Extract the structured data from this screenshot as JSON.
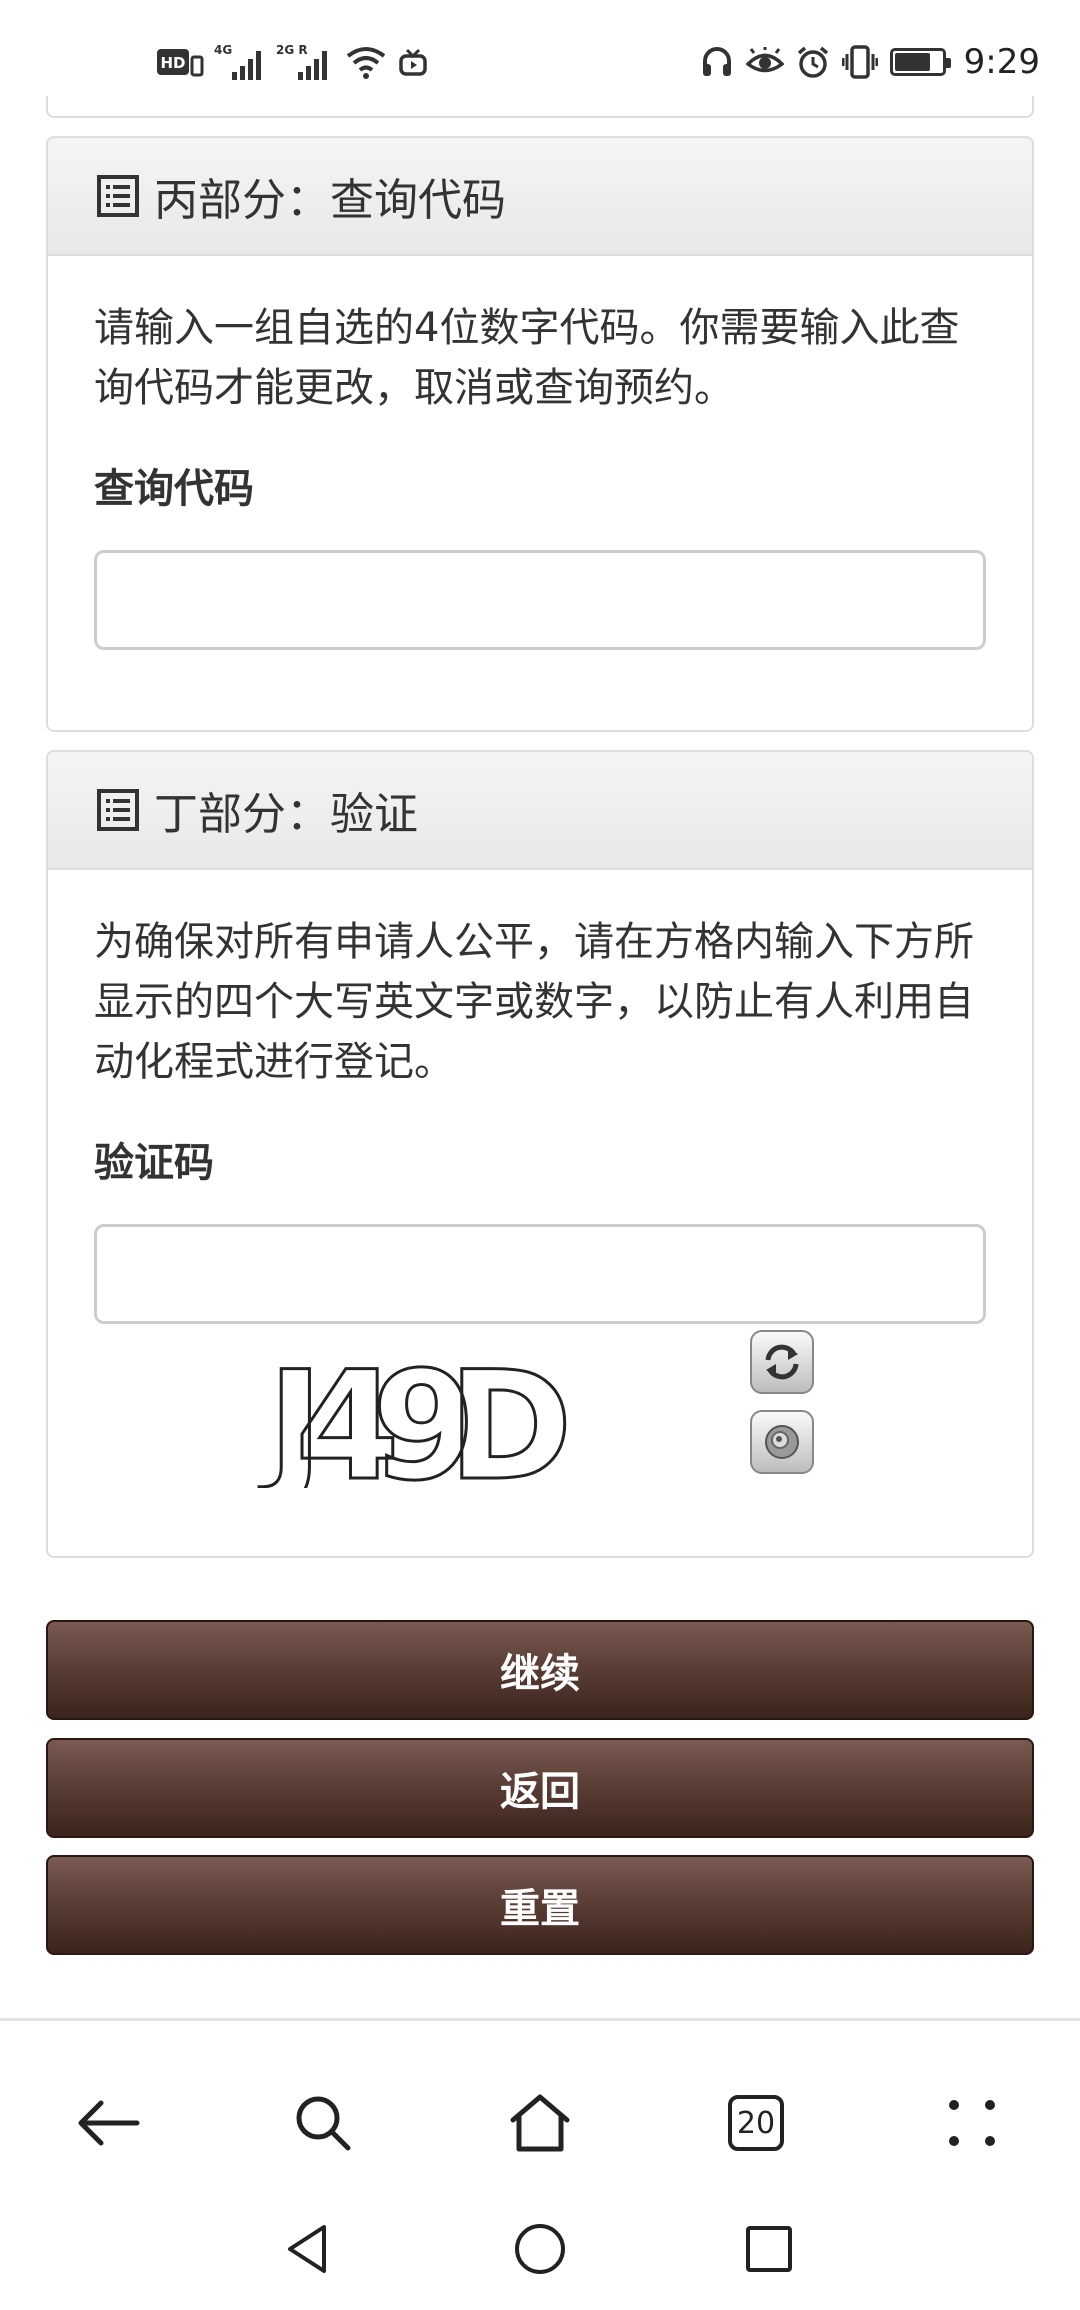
{
  "status_bar": {
    "left_indicators": [
      "HD",
      "4G",
      "2G R"
    ],
    "time": "9:29",
    "icons": [
      "hd-icon",
      "signal-4g-icon",
      "signal-2g-icon",
      "wifi-icon",
      "tv-icon",
      "headphones-icon",
      "eye-icon",
      "alarm-icon",
      "vibrate-icon",
      "battery-icon"
    ],
    "battery_level": 0.75
  },
  "section_c": {
    "title": "丙部分：查询代码",
    "description": "请输入一组自选的4位数字代码。你需要输入此查询代码才能更改，取消或查询预约。",
    "field_label": "查询代码",
    "field_value": ""
  },
  "section_d": {
    "title": "丁部分：验证",
    "description": "为确保对所有申请人公平，请在方格内输入下方所显示的四个大写英文字或数字，以防止有人利用自动化程式进行登记。",
    "field_label": "验证码",
    "field_value": "",
    "captcha_text": "J49D"
  },
  "buttons": {
    "continue": "继续",
    "back": "返回",
    "reset": "重置"
  },
  "browser_toolbar": {
    "tab_count": "20",
    "items": [
      "back-arrow-icon",
      "search-icon",
      "home-icon",
      "tabs-icon",
      "more-icon"
    ]
  },
  "system_nav": {
    "items": [
      "nav-back-icon",
      "nav-home-icon",
      "nav-recents-icon"
    ]
  },
  "colors": {
    "button_top": "#7a5a52",
    "button_bottom": "#3b241c",
    "panel_header": "#efefef",
    "border": "#dddddd"
  }
}
